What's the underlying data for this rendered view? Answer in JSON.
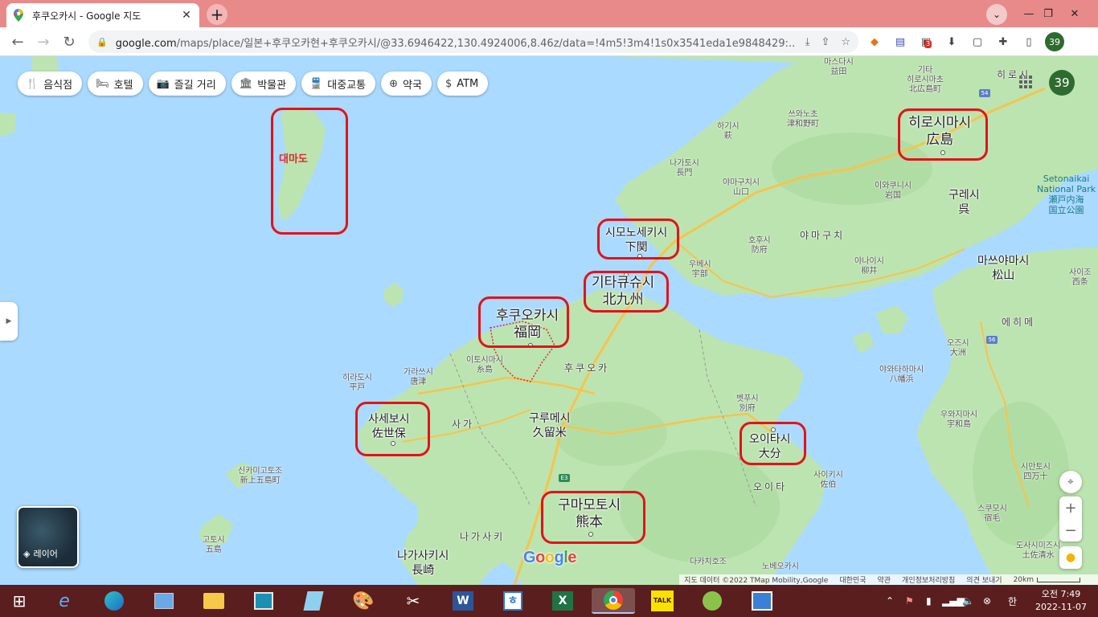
{
  "browser": {
    "tab_title": "후쿠오카시 - Google 지도",
    "url_host": "google.com",
    "url_path": "/maps/place/일본+후쿠오카현+후쿠오카시/@33.6946422,130.4924006,8.46z/data=!4m5!3m4!1s0x3541eda1e9848429:...",
    "extension_badge": "3",
    "profile_number": "39"
  },
  "map": {
    "chips": [
      {
        "label": "음식점",
        "icon": "fork-knife-icon"
      },
      {
        "label": "호텔",
        "icon": "bed-icon"
      },
      {
        "label": "즐길 거리",
        "icon": "camera-icon"
      },
      {
        "label": "박물관",
        "icon": "museum-icon"
      },
      {
        "label": "대중교통",
        "icon": "train-icon"
      },
      {
        "label": "약국",
        "icon": "pharmacy-icon"
      },
      {
        "label": "ATM",
        "icon": "atm-icon"
      }
    ],
    "avatar_number": "39",
    "layer_label": "레이어",
    "google_logo": "Google",
    "attribution": {
      "data": "지도 데이터 ©2022 TMap Mobility,Google",
      "country": "대한민국",
      "terms": "약관",
      "privacy": "개인정보처리방침",
      "feedback": "의견 보내기",
      "scale": "20km"
    },
    "annotations": {
      "tsushima": "대마도"
    },
    "cities": {
      "fukuoka_ko": "후쿠오카시",
      "fukuoka_ja": "福岡",
      "kitakyushu_ko": "기타큐슈시",
      "kitakyushu_ja": "北九州",
      "shimonoseki_ko": "시모노세키시",
      "shimonoseki_ja": "下関",
      "hiroshima_ko": "히로시마시",
      "hiroshima_ja": "広島",
      "sasebo_ko": "사세보시",
      "sasebo_ja": "佐世保",
      "oita_ko": "오이타시",
      "oita_ja": "大分",
      "kumamoto_ko": "구마모토시",
      "kumamoto_ja": "熊本",
      "kurume_ko": "구루메시",
      "kurume_ja": "久留米",
      "nagasaki_ko": "나가사키시",
      "nagasaki_ja": "長崎",
      "matsuyama_ko": "마쓰야마시",
      "matsuyama_ja": "松山",
      "kure_ko": "구레시",
      "kure_ja": "呉"
    },
    "small_labels": {
      "masuda": "마스다시\n益田",
      "kita_hiroshima": "기타\n히로시마초\n北広島町",
      "tsuwano": "쓰와노초\n津和野町",
      "hagi": "하기시\n萩",
      "nagato": "나가토시\n長門",
      "yamaguchi": "야마구치시\n山口",
      "iwakuni": "이와쿠니시\n岩国",
      "hofu": "호후시\n防府",
      "ube": "우베시\n宇部",
      "yanai": "야나이시\n柳井",
      "itoshima": "이토시마시\n糸島",
      "karatsu": "가라쓰시\n唐津",
      "hirado": "히라도시\n平戸",
      "beppu": "벳푸시\n別府",
      "saiki": "사이키시\n佐伯",
      "ozu": "오즈시\n大洲",
      "yawatahama": "야와타하마시\n八幡浜",
      "uwajima": "우와지마시\n宇和島",
      "shimanto": "시만토시\n四万十",
      "sukumo": "스쿠모시\n宿毛",
      "tosashimizu": "도사시미즈시\n土佐清水",
      "saijo": "사이조\n西条",
      "shinkamigoto": "신카미고토조\n新上五島町",
      "goto": "고토시\n五島",
      "takachiho": "다카치호조",
      "nobeoka": "노베오카시"
    },
    "regions": {
      "yamaguchi": "야마구치",
      "fukuoka": "후쿠오카",
      "saga": "사가",
      "nagasaki": "나가사키",
      "oita": "오이타",
      "ehime": "에히메",
      "hiroshima": "히로시"
    },
    "park": "Setonaikai\nNational Park\n瀬戸内海\n国立公園",
    "road_numbers": {
      "r54": "54",
      "r56": "56",
      "e3": "E3"
    }
  },
  "taskbar": {
    "apps": [
      "start",
      "ie",
      "edge",
      "control-panel",
      "explorer",
      "photos",
      "notepad",
      "paint",
      "snipping",
      "word",
      "hangul",
      "excel",
      "chrome",
      "kakaotalk",
      "store",
      "media"
    ],
    "kakao_label": "TALK",
    "ime": "한",
    "time": "오전 7:49",
    "date": "2022-11-07"
  },
  "colors": {
    "titlebar": "#e88a8a",
    "water": "#aadaff",
    "land": "#bce4b0",
    "annotation_red": "#e3121b",
    "taskbar": "#5a1e1e"
  }
}
